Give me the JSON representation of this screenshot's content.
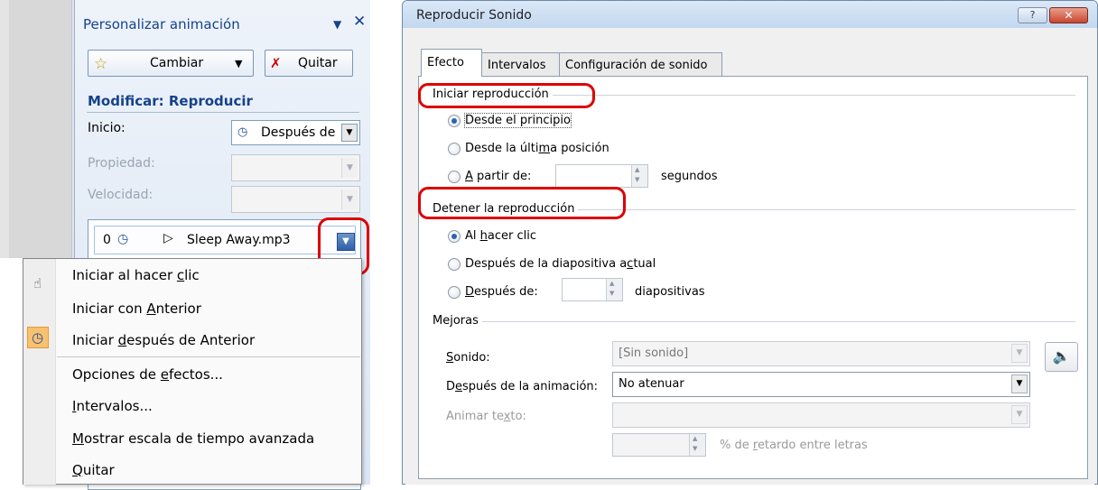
{
  "left_panel": {
    "title": "Personalizar animación",
    "title_dropdown_icon": "triangle-down",
    "close_icon": "close-x",
    "change_button": {
      "label": "Cambiar",
      "icon": "star-icon"
    },
    "remove_button": {
      "label": "Quitar",
      "icon": "remove-star-icon"
    },
    "section_header": "Modificar: Reproducir",
    "start_label": "Inicio:",
    "start_value": "Después de",
    "property_label": "Propiedad:",
    "speed_label": "Velocidad:",
    "list_item": {
      "index": "0",
      "name": "Sleep Away.mp3"
    },
    "context_menu": [
      {
        "label": "Iniciar al hacer clic",
        "icon": "mouse-icon"
      },
      {
        "label": "Iniciar con Anterior"
      },
      {
        "label": "Iniciar después de Anterior",
        "icon": "clock-icon",
        "checked": true
      },
      {
        "label": "Opciones de efectos..."
      },
      {
        "label": "Intervalos..."
      },
      {
        "label": "Mostrar escala de tiempo avanzada"
      },
      {
        "label": "Quitar"
      }
    ]
  },
  "dialog": {
    "title": "Reproducir Sonido",
    "help_button": "?",
    "close_button": "✕",
    "tabs": [
      "Efecto",
      "Intervalos",
      "Configuración de sonido"
    ],
    "active_tab": "Efecto",
    "start_group": {
      "heading": "Iniciar reproducción",
      "options": [
        "Desde el principio",
        "Desde la última posición",
        "A partir de:"
      ],
      "selected": "Desde el principio",
      "seconds_suffix": "segundos"
    },
    "stop_group": {
      "heading": "Detener la reproducción",
      "options": [
        "Al hacer clic",
        "Después de la diapositiva actual",
        "Después de:"
      ],
      "selected": "Al hacer clic",
      "slides_suffix": "diapositivas"
    },
    "enhancements": {
      "heading": "Mejoras",
      "sound_label": "Sonido:",
      "sound_value": "[Sin sonido]",
      "after_anim_label": "Después de la animación:",
      "after_anim_value": "No atenuar",
      "animate_text_label": "Animar texto:",
      "animate_text_value": "",
      "delay_suffix": "% de retardo entre letras"
    },
    "colors": {
      "highlight_box": "#dd0000",
      "radio_selected": "#2c62b6"
    }
  }
}
